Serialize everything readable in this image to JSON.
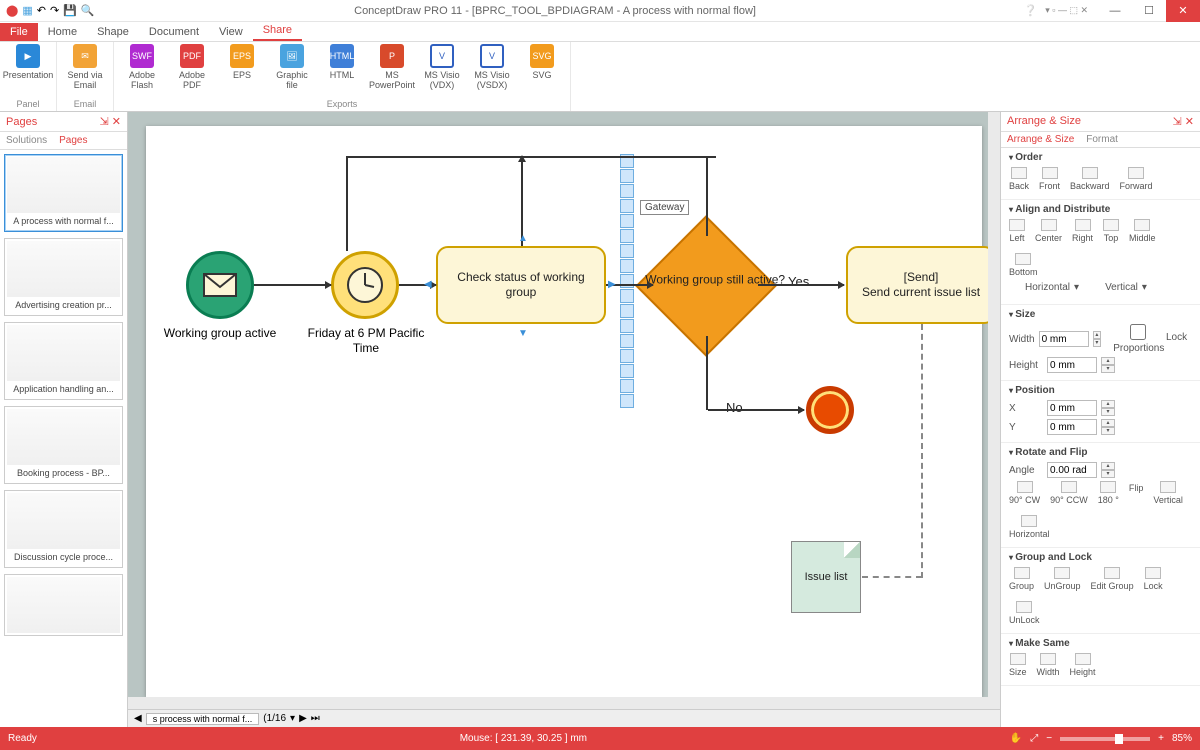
{
  "app": {
    "title": "ConceptDraw PRO 11 - [BPRC_TOOL_BPDIAGRAM - A process with normal flow]"
  },
  "tabs": {
    "file": "File",
    "items": [
      "Home",
      "Shape",
      "Document",
      "View",
      "Share"
    ],
    "active": "Share"
  },
  "ribbon": {
    "groups": [
      {
        "label": "Panel",
        "buttons": [
          {
            "label": "Presentation",
            "color": "#2a88d8"
          }
        ]
      },
      {
        "label": "Email",
        "buttons": [
          {
            "label": "Send via Email",
            "color": "#f2a336"
          }
        ]
      },
      {
        "label": "Exports",
        "buttons": [
          {
            "label": "Adobe Flash",
            "color": "#b02bd1"
          },
          {
            "label": "Adobe PDF",
            "color": "#e04040"
          },
          {
            "label": "EPS",
            "color": "#f29b1d"
          },
          {
            "label": "Graphic file",
            "color": "#4aa3df"
          },
          {
            "label": "HTML",
            "color": "#3f7fd8"
          },
          {
            "label": "MS PowerPoint",
            "color": "#d84a2b"
          },
          {
            "label": "MS Visio (VDX)",
            "color": "#3060c0"
          },
          {
            "label": "MS Visio (VSDX)",
            "color": "#3060c0"
          },
          {
            "label": "SVG",
            "color": "#f29b1d"
          }
        ]
      }
    ]
  },
  "left": {
    "title": "Pages",
    "tabs": {
      "solutions": "Solutions",
      "pages": "Pages"
    },
    "pin_close": {
      "pin": "📌",
      "close": "✕"
    },
    "thumbs": [
      "A process with normal f...",
      "Advertising creation pr...",
      "Application handling an...",
      "Booking  process - BP...",
      "Discussion cycle proce..."
    ]
  },
  "sheet": {
    "tab": "s process with normal f...",
    "pager": "(1/16"
  },
  "diagram": {
    "start_label": "Working group active",
    "timer_label": "Friday at 6 PM Pacific Time",
    "task1": "Check status of working group",
    "gateway": "Working group still active?",
    "gateway_tooltip": "Gateway",
    "yes": "Yes",
    "no": "No",
    "task2_line1": "[Send]",
    "task2_line2": "Send current issue list",
    "note": "Issue list"
  },
  "right": {
    "title": "Arrange & Size",
    "tabs": {
      "arrange": "Arrange & Size",
      "format": "Format"
    },
    "order": {
      "head": "Order",
      "back": "Back",
      "front": "Front",
      "backward": "Backward",
      "forward": "Forward"
    },
    "align": {
      "head": "Align and Distribute",
      "left": "Left",
      "center": "Center",
      "right": "Right",
      "top": "Top",
      "middle": "Middle",
      "bottom": "Bottom",
      "horiz": "Horizontal",
      "vert": "Vertical"
    },
    "size": {
      "head": "Size",
      "width": "Width",
      "height": "Height",
      "val": "0 mm",
      "lock": "Lock Proportions"
    },
    "pos": {
      "head": "Position",
      "x": "X",
      "y": "Y",
      "val": "0 mm"
    },
    "rotate": {
      "head": "Rotate and Flip",
      "angle": "Angle",
      "val": "0.00 rad",
      "cw": "90° CW",
      "ccw": "90° CCW",
      "r180": "180 °",
      "flip": "Flip",
      "v": "Vertical",
      "h": "Horizontal"
    },
    "glock": {
      "head": "Group and Lock",
      "group": "Group",
      "ungroup": "UnGroup",
      "edit": "Edit Group",
      "lock": "Lock",
      "unlock": "UnLock"
    },
    "same": {
      "head": "Make Same",
      "size": "Size",
      "width": "Width",
      "height": "Height"
    }
  },
  "status": {
    "ready": "Ready",
    "mouse": "Mouse: [ 231.39, 30.25 ] mm",
    "zoom": "85%"
  }
}
